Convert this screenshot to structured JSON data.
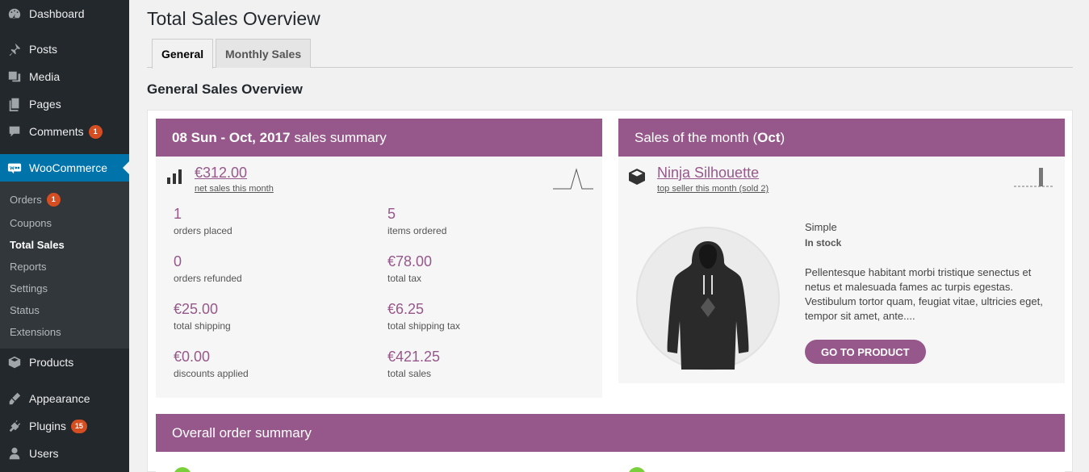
{
  "sidebar": {
    "top_items": [
      {
        "label": "Dashboard",
        "icon": "dashboard-icon"
      },
      {
        "label": "Posts",
        "icon": "pin-icon"
      },
      {
        "label": "Media",
        "icon": "media-icon"
      },
      {
        "label": "Pages",
        "icon": "pages-icon"
      },
      {
        "label": "Comments",
        "icon": "comments-icon",
        "badge": "1"
      },
      {
        "label": "WooCommerce",
        "icon": "woo-icon"
      }
    ],
    "submenu": [
      {
        "label": "Orders",
        "badge": "1"
      },
      {
        "label": "Coupons"
      },
      {
        "label": "Total Sales"
      },
      {
        "label": "Reports"
      },
      {
        "label": "Settings"
      },
      {
        "label": "Status"
      },
      {
        "label": "Extensions"
      }
    ],
    "bottom_items": [
      {
        "label": "Products",
        "icon": "products-icon"
      },
      {
        "label": "Appearance",
        "icon": "appearance-icon"
      },
      {
        "label": "Plugins",
        "icon": "plugins-icon",
        "badge": "15"
      },
      {
        "label": "Users",
        "icon": "users-icon"
      }
    ]
  },
  "page": {
    "title": "Total Sales Overview",
    "tabs": [
      {
        "label": "General"
      },
      {
        "label": "Monthly Sales"
      }
    ],
    "section_title": "General Sales Overview"
  },
  "summary": {
    "title_bold": "08 Sun - Oct, 2017",
    "title_rest": "sales summary",
    "net_sales": "€312.00",
    "net_sales_label": "net sales this month",
    "stats": [
      {
        "value": "1",
        "label": "orders placed"
      },
      {
        "value": "5",
        "label": "items ordered"
      },
      {
        "value": "0",
        "label": "orders refunded"
      },
      {
        "value": "€78.00",
        "label": "total tax"
      },
      {
        "value": "€25.00",
        "label": "total shipping"
      },
      {
        "value": "€6.25",
        "label": "total shipping tax"
      },
      {
        "value": "€0.00",
        "label": "discounts applied"
      },
      {
        "value": "€421.25",
        "label": "total sales"
      }
    ]
  },
  "month": {
    "title_pre": "Sales of the month (",
    "title_bold": "Oct",
    "title_post": ")",
    "product_name": "Ninja Silhouette",
    "product_sub": "top seller this month (sold 2)",
    "type": "Simple",
    "stock": "In stock",
    "description": "Pellentesque habitant morbi tristique senectus et netus et malesuada fames ac turpis egestas. Vestibulum tortor quam, feugiat vitae, ultricies eget, tempor sit amet, ante....",
    "button": "GO TO PRODUCT"
  },
  "overall": {
    "title": "Overall order summary"
  },
  "colors": {
    "accent": "#96588a",
    "sidebar": "#23282d",
    "highlight": "#0073aa",
    "badge": "#d54e21"
  }
}
